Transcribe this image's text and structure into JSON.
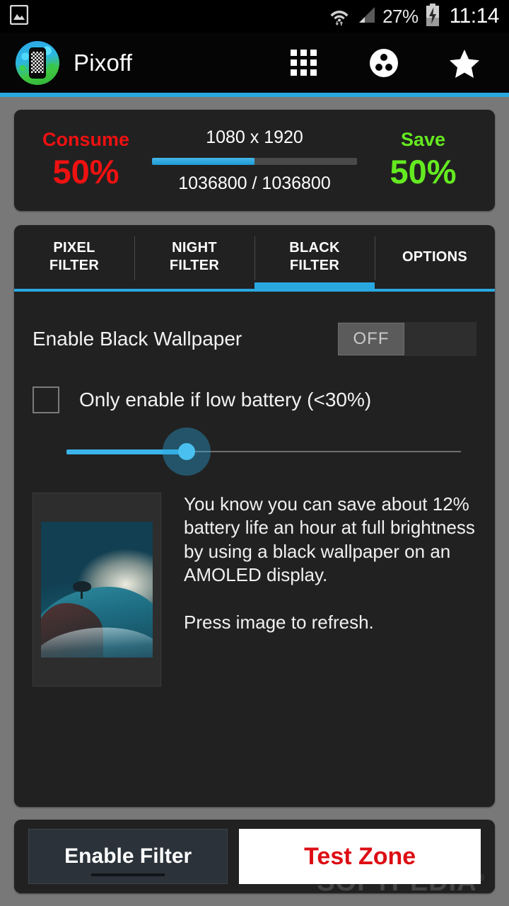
{
  "statusbar": {
    "left_icon": "image-icon",
    "wifi_icon": "wifi-icon",
    "signal_icon": "cell-signal-icon",
    "battery_percent": "27%",
    "battery_icon": "battery-charging-icon",
    "clock": "11:14"
  },
  "appbar": {
    "title": "Pixoff",
    "logo": "pixoff-logo-icon",
    "actions": [
      {
        "name": "grid-icon"
      },
      {
        "name": "film-reel-icon"
      },
      {
        "name": "star-icon"
      }
    ]
  },
  "stats": {
    "consume_label": "Consume",
    "consume_value": "50%",
    "save_label": "Save",
    "save_value": "50%",
    "resolution": "1080 x 1920",
    "pixel_count": "1036800 / 1036800",
    "progress_percent": 50,
    "consume_color": "#ee1111",
    "save_color": "#64ea20",
    "progress_color": "#29a8e0"
  },
  "tabs": [
    {
      "label": "PIXEL\nFILTER",
      "line1": "PIXEL",
      "line2": "FILTER",
      "active": false
    },
    {
      "label": "NIGHT\nFILTER",
      "line1": "NIGHT",
      "line2": "FILTER",
      "active": false
    },
    {
      "label": "BLACK\nFILTER",
      "line1": "BLACK",
      "line2": "FILTER",
      "active": true
    },
    {
      "label": "OPTIONS",
      "line1": "OPTIONS",
      "line2": "",
      "active": false
    }
  ],
  "black_filter": {
    "enable_wallpaper_label": "Enable Black Wallpaper",
    "switch_state": "OFF",
    "low_battery_label": "Only enable if low battery (<30%)",
    "low_battery_checked": false,
    "slider_value": 25,
    "thumbnail_name": "wallpaper-preview",
    "info_paragraph": "You know you can save about 12% battery life an hour at full brightness by using a black wallpaper on an AMOLED display.",
    "info_hint": "Press image to refresh."
  },
  "bottom": {
    "enable_filter_label": "Enable Filter",
    "test_zone_label": "Test Zone",
    "test_zone_color": "#dd0d14",
    "watermark": "SOFTPEDIA"
  }
}
